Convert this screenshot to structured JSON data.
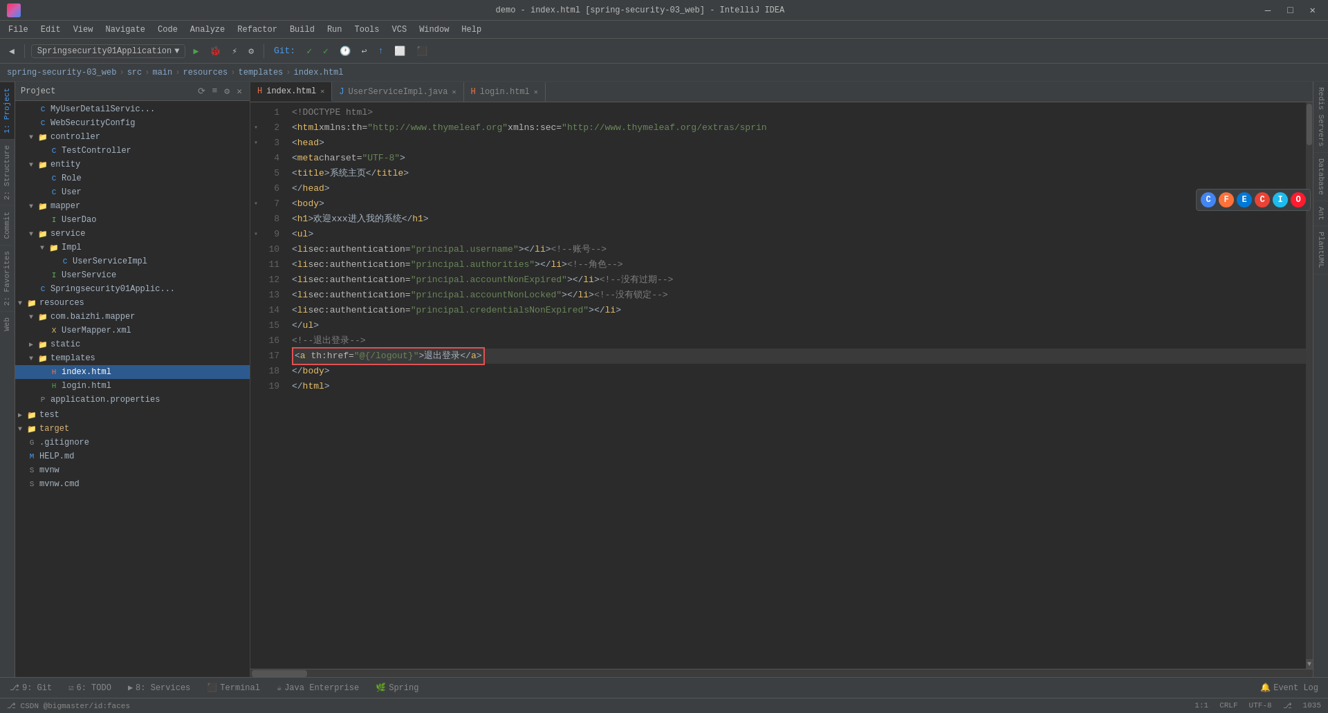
{
  "titleBar": {
    "title": "demo - index.html [spring-security-03_web] - IntelliJ IDEA",
    "minimize": "—",
    "maximize": "□",
    "close": "✕"
  },
  "menuBar": {
    "items": [
      "File",
      "Edit",
      "View",
      "Navigate",
      "Code",
      "Analyze",
      "Refactor",
      "Build",
      "Run",
      "Tools",
      "VCS",
      "Window",
      "Help"
    ]
  },
  "breadcrumb": {
    "items": [
      "spring-security-03_web",
      "src",
      "main",
      "resources",
      "templates",
      "index.html"
    ]
  },
  "tabs": [
    {
      "label": "index.html",
      "active": true,
      "icon": "html"
    },
    {
      "label": "UserServiceImpl.java",
      "active": false,
      "icon": "java"
    },
    {
      "label": "login.html",
      "active": false,
      "icon": "html"
    }
  ],
  "projectPanel": {
    "title": "Project",
    "items": [
      {
        "indent": 0,
        "type": "file-java",
        "label": "MyUserDetailServic...",
        "hasArrow": false
      },
      {
        "indent": 0,
        "type": "file-java",
        "label": "WebSecurityConfig",
        "hasArrow": false
      },
      {
        "indent": 0,
        "type": "folder",
        "label": "controller",
        "hasArrow": true,
        "open": true
      },
      {
        "indent": 1,
        "type": "file-java",
        "label": "TestController",
        "hasArrow": false
      },
      {
        "indent": 0,
        "type": "folder",
        "label": "entity",
        "hasArrow": true,
        "open": true
      },
      {
        "indent": 1,
        "type": "file-java",
        "label": "Role",
        "hasArrow": false
      },
      {
        "indent": 1,
        "type": "file-java",
        "label": "User",
        "hasArrow": false
      },
      {
        "indent": 0,
        "type": "folder",
        "label": "mapper",
        "hasArrow": true,
        "open": true
      },
      {
        "indent": 1,
        "type": "file-green",
        "label": "UserDao",
        "hasArrow": false
      },
      {
        "indent": 0,
        "type": "folder",
        "label": "service",
        "hasArrow": true,
        "open": true
      },
      {
        "indent": 1,
        "type": "folder",
        "label": "Impl",
        "hasArrow": true,
        "open": true
      },
      {
        "indent": 2,
        "type": "file-java",
        "label": "UserServiceImpl",
        "hasArrow": false
      },
      {
        "indent": 1,
        "type": "file-green",
        "label": "UserService",
        "hasArrow": false
      },
      {
        "indent": 0,
        "type": "file-java",
        "label": "Springsecurity01Applic...",
        "hasArrow": false
      },
      {
        "indent": 0,
        "type": "folder",
        "label": "resources",
        "hasArrow": true,
        "open": true
      },
      {
        "indent": 1,
        "type": "folder",
        "label": "com.baizhi.mapper",
        "hasArrow": true,
        "open": true
      },
      {
        "indent": 2,
        "type": "file-xml",
        "label": "UserMapper.xml",
        "hasArrow": false
      },
      {
        "indent": 1,
        "type": "folder",
        "label": "static",
        "hasArrow": false,
        "open": false
      },
      {
        "indent": 1,
        "type": "folder",
        "label": "templates",
        "hasArrow": true,
        "open": true
      },
      {
        "indent": 2,
        "type": "file-html",
        "label": "index.html",
        "selected": true,
        "hasArrow": false
      },
      {
        "indent": 2,
        "type": "file-html",
        "label": "login.html",
        "hasArrow": false
      },
      {
        "indent": 1,
        "type": "file-props",
        "label": "application.properties",
        "hasArrow": false
      }
    ]
  },
  "codeLines": [
    {
      "num": 1,
      "fold": false,
      "content": "<!DOCTYPE html>",
      "type": "doctype"
    },
    {
      "num": 2,
      "fold": true,
      "content": "<html xmlns:th=\"http://www.thymeleaf.org\" xmlns:sec=\"http://www.thymeleaf.org/extras/sprin",
      "type": "html-open"
    },
    {
      "num": 3,
      "fold": true,
      "content": "<head>",
      "type": "head-open"
    },
    {
      "num": 4,
      "fold": false,
      "content": "    <meta charset=\"UTF-8\">",
      "type": "meta"
    },
    {
      "num": 5,
      "fold": false,
      "content": "    <title>系统主页</title>",
      "type": "title"
    },
    {
      "num": 6,
      "fold": false,
      "content": "</head>",
      "type": "head-close"
    },
    {
      "num": 7,
      "fold": true,
      "content": "<body>",
      "type": "body-open"
    },
    {
      "num": 8,
      "fold": false,
      "content": "    <h1>欢迎xxx进入我的系统</h1>",
      "type": "h1"
    },
    {
      "num": 9,
      "fold": true,
      "content": "    <ul>",
      "type": "ul-open"
    },
    {
      "num": 10,
      "fold": false,
      "content": "        <li sec:authentication=\"principal.username\"></li><!--账号-->",
      "type": "li"
    },
    {
      "num": 11,
      "fold": false,
      "content": "        <li sec:authentication=\"principal.authorities\"></li><!--角色-->",
      "type": "li"
    },
    {
      "num": 12,
      "fold": false,
      "content": "        <li sec:authentication=\"principal.accountNonExpired\"></li><!--没有过期-->",
      "type": "li"
    },
    {
      "num": 13,
      "fold": false,
      "content": "        <li sec:authentication=\"principal.accountNonLocked\"></li><!--没有锁定-->",
      "type": "li"
    },
    {
      "num": 14,
      "fold": false,
      "content": "        <li sec:authentication=\"principal.credentialsNonExpired\"></li>",
      "type": "li"
    },
    {
      "num": 15,
      "fold": false,
      "content": "    </ul>",
      "type": "ul-close"
    },
    {
      "num": 16,
      "fold": false,
      "content": "    <!--退出登录-->",
      "type": "comment"
    },
    {
      "num": 17,
      "fold": false,
      "content": "    <a th:href=\"@{/logout}\">退出登录</a>",
      "type": "logout",
      "highlight": true
    },
    {
      "num": 18,
      "fold": false,
      "content": "</body>",
      "type": "body-close"
    },
    {
      "num": 19,
      "fold": false,
      "content": "</html>",
      "type": "html-close"
    }
  ],
  "bottomTabs": [
    {
      "label": "9: Git",
      "icon": "git"
    },
    {
      "label": "6: TODO",
      "icon": "todo"
    },
    {
      "label": "8: Services",
      "icon": "services"
    },
    {
      "label": "Terminal",
      "icon": "terminal"
    },
    {
      "label": "Java Enterprise",
      "icon": "java"
    },
    {
      "label": "Spring",
      "icon": "spring"
    }
  ],
  "statusBar": {
    "left": "",
    "position": "1:1",
    "encoding": "CRLF",
    "charset": "UTF-8",
    "git": "CSDN @bigmaster/id:faces",
    "eventLog": "Event Log",
    "lineCol": "1035"
  },
  "rightTabs": [
    "Redis Servers",
    "Database",
    "Ant",
    "PlantUML"
  ],
  "runConfig": "Springsecurity01Application",
  "browserIcons": [
    {
      "name": "Chrome",
      "color": "#4285F4",
      "bg": "#fff"
    },
    {
      "name": "Firefox",
      "color": "#FF7139",
      "bg": "#fff"
    },
    {
      "name": "Edge",
      "color": "#0078D7",
      "bg": "#fff"
    },
    {
      "name": "Chrome2",
      "color": "#EA4335",
      "bg": "#fff"
    },
    {
      "name": "IE",
      "color": "#1EBBEE",
      "bg": "#fff"
    },
    {
      "name": "Opera",
      "color": "#FF1B2D",
      "bg": "#fff"
    }
  ]
}
